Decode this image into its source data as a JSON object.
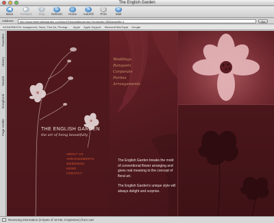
{
  "window": {
    "title": "The English Garden"
  },
  "toolbar": {
    "buttons": [
      {
        "label": "Back",
        "icon": "arrow-left-icon",
        "disabled": false
      },
      {
        "label": "Forward",
        "icon": "arrow-right-icon",
        "disabled": true
      },
      {
        "label": "Stop",
        "icon": "stop-icon",
        "disabled": true
      },
      {
        "label": "Refresh",
        "icon": "refresh-icon",
        "disabled": false
      },
      {
        "label": "Home",
        "icon": "home-icon",
        "disabled": false
      },
      {
        "label": "AutoFill",
        "icon": "autofill-icon",
        "disabled": false
      },
      {
        "label": "Print",
        "icon": "print-icon",
        "disabled": false
      },
      {
        "label": "Mail",
        "icon": "mail-icon",
        "disabled": false
      }
    ]
  },
  "address": {
    "label": "Address",
    "url": "http://www.theenglishgarden.com/store/Shopaddtocart.asp?productid=265&quantity=1",
    "go_label": "Go"
  },
  "favorites": {
    "items": [
      "WONDRBOOK: Assignment, Stock, Fine Art, Photogr...",
      "Apple",
      "Apple Support",
      "Microsoft MacTopia",
      "Google"
    ]
  },
  "sidebar": {
    "tabs": [
      "Favorites",
      "History",
      "Search",
      "Scrapbook",
      "Page Holder"
    ]
  },
  "page": {
    "taglines": [
      "Weddings",
      "Banquets",
      "Corporate",
      "Parties",
      "Arrangements"
    ],
    "logo": {
      "title": "THE ENGLISH GARDEN",
      "subtitle": "the art of living beautifully"
    },
    "nav": [
      "ABOUT US",
      "ARRANGEMENTS",
      "WEDDINGS",
      "NEWS",
      "CONTACT"
    ],
    "paragraphs": [
      "The English Garden breaks the mold of conventional flower arranging and gives real meaning to the concept of floral art.",
      "The English Garden's unique style will always delight and surprise."
    ]
  },
  "status": {
    "text": "Receiving information (0 bytes of 18 KB, 0 bytes/sec) from cart"
  },
  "colors": {
    "page_bg": "#4a161b",
    "nav_link": "#d9572f",
    "tagline": "#c9956a"
  }
}
